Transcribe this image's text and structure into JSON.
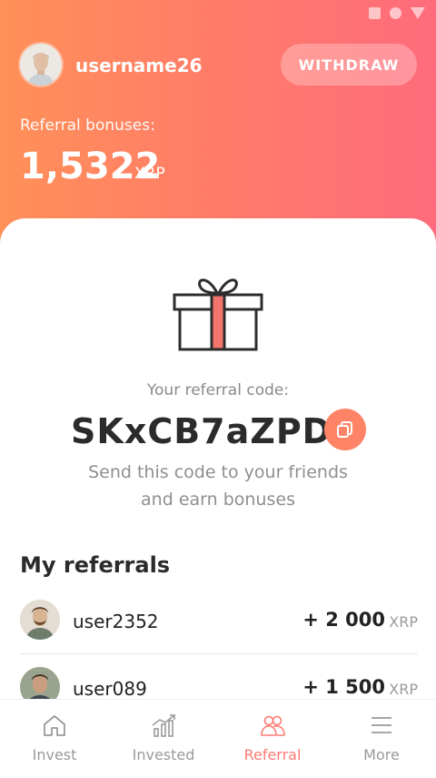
{
  "status_bar": {
    "icons": [
      "square-icon",
      "circle-icon",
      "triangle-icon"
    ]
  },
  "header": {
    "username": "username26",
    "withdraw_label": "WITHDRAW",
    "bonus_label": "Referral bonuses:",
    "bonus_value": "1,5322",
    "bonus_unit": "XRP"
  },
  "referral": {
    "code_label": "Your referral code:",
    "code": "SKxCB7aZPD",
    "desc_line1": "Send this code to your friends",
    "desc_line2": "and earn bonuses"
  },
  "my_referrals": {
    "title": "My referrals",
    "items": [
      {
        "name": "user2352",
        "amount": "+ 2 000",
        "unit": "XRP"
      },
      {
        "name": "user089",
        "amount": "+ 1 500",
        "unit": "XRP"
      }
    ]
  },
  "nav": {
    "items": [
      {
        "label": "Invest",
        "icon": "home-icon"
      },
      {
        "label": "Invested",
        "icon": "chart-icon"
      },
      {
        "label": "Referral",
        "icon": "users-icon"
      },
      {
        "label": "More",
        "icon": "menu-icon"
      }
    ],
    "active": "Referral"
  },
  "colors": {
    "header_gradient_start": "#ff9058",
    "header_gradient_end": "#ff6b7c",
    "accent": "#ff7a73",
    "copy_button": "#ff8467"
  }
}
